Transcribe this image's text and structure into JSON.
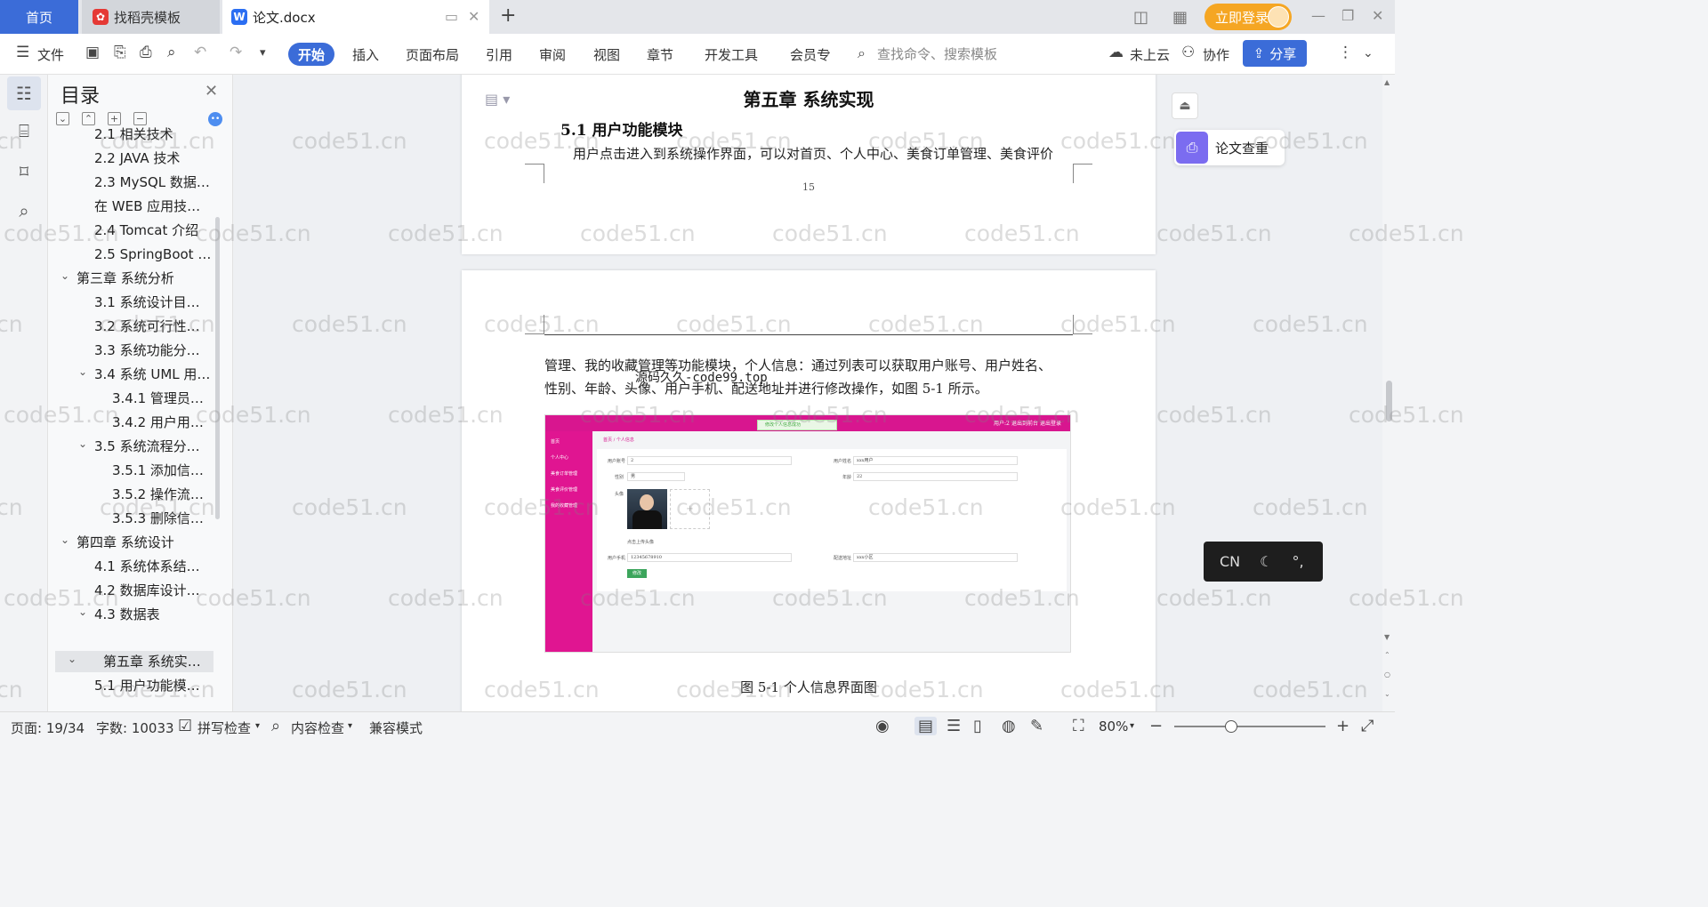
{
  "tabbar": {
    "home": "首页",
    "tab1": "找稻壳模板",
    "tab2": "论文.docx",
    "login": "立即登录"
  },
  "toolbar": {
    "file": "文件",
    "menus": [
      "开始",
      "插入",
      "页面布局",
      "引用",
      "审阅",
      "视图",
      "章节",
      "开发工具",
      "会员专"
    ],
    "search_placeholder": "查找命令、搜索模板",
    "cloud": "未上云",
    "collab": "协作",
    "share": "分享"
  },
  "toc": {
    "title": "目录",
    "items": [
      {
        "label": "2.1 相关技术",
        "level": 2
      },
      {
        "label": "2.2 JAVA 技术",
        "level": 2
      },
      {
        "label": "2.3 MySQL 数据…",
        "level": 2
      },
      {
        "label": "在 WEB 应用技…",
        "level": 2
      },
      {
        "label": "2.4 Tomcat 介绍",
        "level": 2
      },
      {
        "label": "2.5 SpringBoot …",
        "level": 2
      },
      {
        "label": "第三章 系统分析",
        "level": 1
      },
      {
        "label": "3.1 系统设计目…",
        "level": 2
      },
      {
        "label": "3.2 系统可行性…",
        "level": 2
      },
      {
        "label": "3.3 系统功能分…",
        "level": 2
      },
      {
        "label": "3.4 系统 UML 用…",
        "level": 2
      },
      {
        "label": "3.4.1 管理员…",
        "level": 3
      },
      {
        "label": "3.4.2 用户用…",
        "level": 3
      },
      {
        "label": "3.5 系统流程分…",
        "level": 2
      },
      {
        "label": "3.5.1 添加信…",
        "level": 3
      },
      {
        "label": "3.5.2 操作流…",
        "level": 3
      },
      {
        "label": "3.5.3 删除信…",
        "level": 3
      },
      {
        "label": "第四章 系统设计",
        "level": 1
      },
      {
        "label": "4.1 系统体系结…",
        "level": 2
      },
      {
        "label": "4.2 数据库设计…",
        "level": 2
      },
      {
        "label": "4.3 数据表",
        "level": 2
      },
      {
        "label": "第五章 系统实…",
        "level": 1
      },
      {
        "label": "5.1 用户功能模…",
        "level": 2
      }
    ]
  },
  "doc": {
    "chapter_title": "第五章 系统实现",
    "section_title": "5.1 用户功能模块",
    "para1": "用户点击进入到系统操作界面，可以对首页、个人中心、美食订单管理、美食评价",
    "page_number": "15",
    "para2_line1": "管理、我的收藏管理等功能模块，个人信息：通过列表可以获取用户账号、用户姓名、",
    "para2_line2": "性别、年龄、头像、用户手机、配送地址并进行修改操作，如图 5-1 所示。",
    "overlay": "源码久久-code99.top",
    "caption": "图 5-1 个人信息界面图"
  },
  "shot": {
    "top_links": [
      "用户:2",
      "退出到前台",
      "退出登录"
    ],
    "tip": "修改个人信息成功",
    "crumb": "首页 / 个人信息",
    "side_items": [
      "首页",
      "个人中心",
      "美食订单管理",
      "美食评价管理",
      "我的收藏管理"
    ],
    "labels": {
      "account": "用户账号",
      "name": "用户姓名",
      "gender": "性别",
      "age": "年龄",
      "avatar": "头像",
      "phone": "用户手机",
      "address": "配送地址",
      "upload_tip": "点击上传头像"
    },
    "values": {
      "account": "2",
      "name": "xxx用户",
      "gender": "男",
      "age": "22",
      "phone": "12345678910",
      "address": "xxx小区"
    },
    "button": "修改"
  },
  "right": {
    "check": "论文查重",
    "ime": [
      "CN",
      "☾",
      "°,"
    ]
  },
  "watermark": "code51.cn",
  "statusbar": {
    "page": "页面: 19/34",
    "words": "字数: 10033",
    "spell": "拼写检查",
    "content": "内容检查",
    "compat": "兼容模式",
    "zoom": "80%"
  }
}
